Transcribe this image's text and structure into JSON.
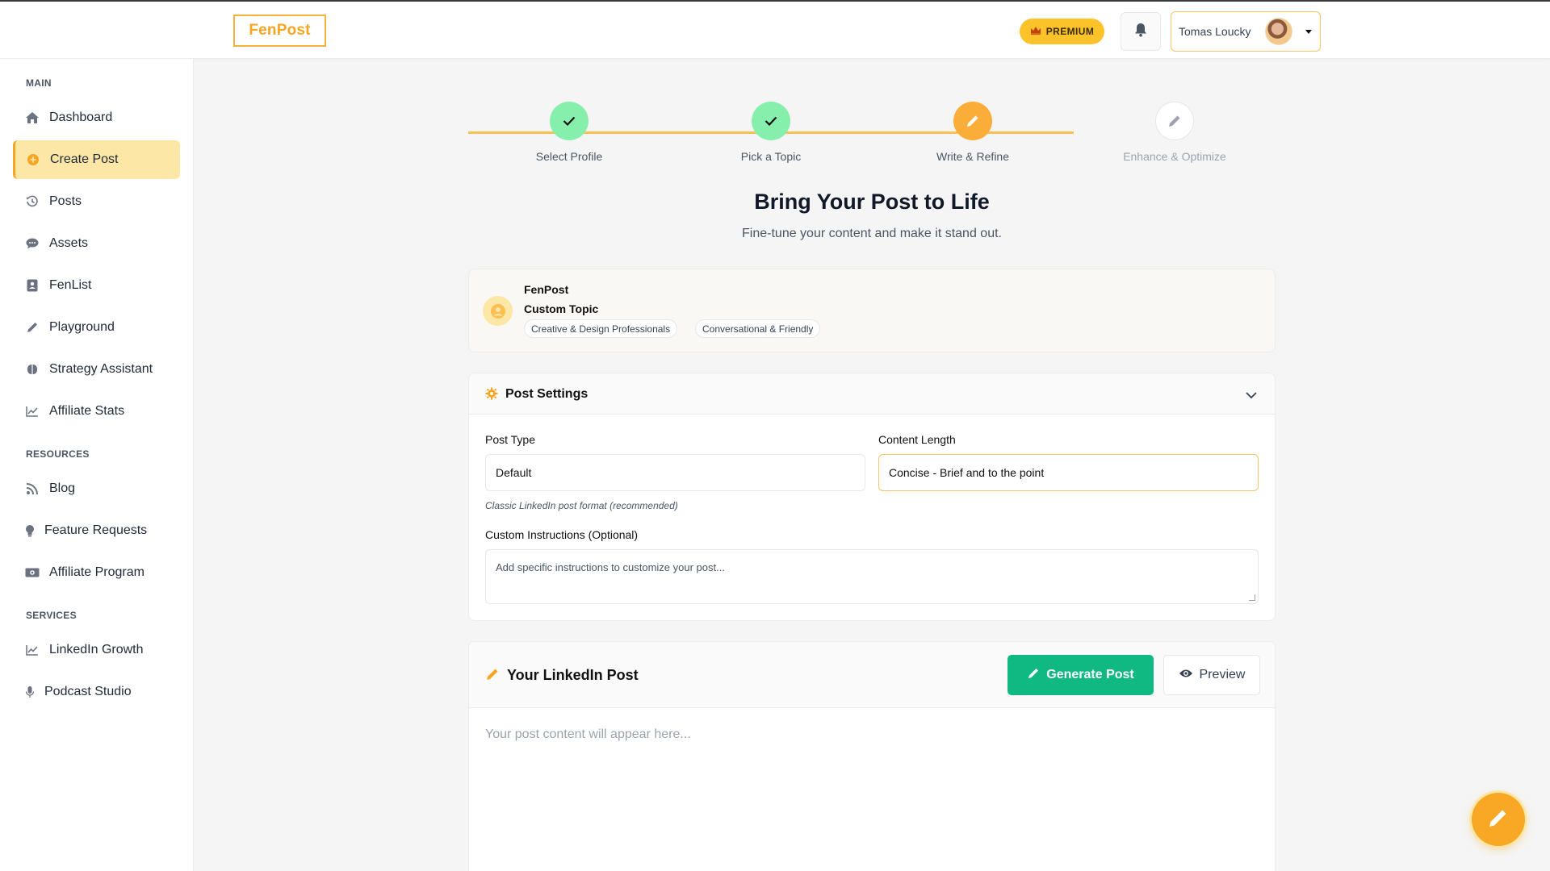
{
  "header": {
    "logo": "FenPost",
    "premium_label": "PREMIUM",
    "user_name": "Tomas Loucky"
  },
  "sidebar": {
    "sections": [
      {
        "label": "MAIN"
      },
      {
        "label": "RESOURCES"
      },
      {
        "label": "SERVICES"
      }
    ],
    "items": [
      {
        "label": "Dashboard",
        "icon": "home-icon"
      },
      {
        "label": "Create Post",
        "icon": "plus-circle-icon",
        "active": true
      },
      {
        "label": "Posts",
        "icon": "history-icon"
      },
      {
        "label": "Assets",
        "icon": "chat-icon"
      },
      {
        "label": "FenList",
        "icon": "contact-card-icon"
      },
      {
        "label": "Playground",
        "icon": "pencil-icon"
      },
      {
        "label": "Strategy Assistant",
        "icon": "brain-icon"
      },
      {
        "label": "Affiliate Stats",
        "icon": "chart-line-icon"
      },
      {
        "label": "Blog",
        "icon": "rss-icon"
      },
      {
        "label": "Feature Requests",
        "icon": "lightbulb-icon"
      },
      {
        "label": "Affiliate Program",
        "icon": "money-icon"
      },
      {
        "label": "LinkedIn Growth",
        "icon": "chart-line-icon"
      },
      {
        "label": "Podcast Studio",
        "icon": "microphone-icon"
      }
    ]
  },
  "stepper": {
    "steps": [
      {
        "label": "Select Profile",
        "status": "complete"
      },
      {
        "label": "Pick a Topic",
        "status": "complete"
      },
      {
        "label": "Write & Refine",
        "status": "current"
      },
      {
        "label": "Enhance & Optimize",
        "status": "upcoming"
      }
    ]
  },
  "main": {
    "title": "Bring Your Post to Life",
    "subtitle": "Fine-tune your content and make it stand out."
  },
  "profile": {
    "name": "FenPost",
    "topic": "Custom Topic",
    "tags": [
      "Creative & Design Professionals",
      "Conversational & Friendly"
    ]
  },
  "settings": {
    "title": "Post Settings",
    "post_type_label": "Post Type",
    "post_type_value": "Default",
    "post_type_hint": "Classic LinkedIn post format (recommended)",
    "content_length_label": "Content Length",
    "content_length_value": "Concise - Brief and to the point",
    "instructions_label": "Custom Instructions (Optional)",
    "instructions_placeholder": "Add specific instructions to customize your post..."
  },
  "post": {
    "title": "Your LinkedIn Post",
    "generate_label": "Generate Post",
    "preview_label": "Preview",
    "placeholder": "Your post content will appear here..."
  },
  "colors": {
    "accent": "#f6a623",
    "success": "#10b981",
    "step_complete": "#86efac",
    "premium": "#fbc329"
  }
}
